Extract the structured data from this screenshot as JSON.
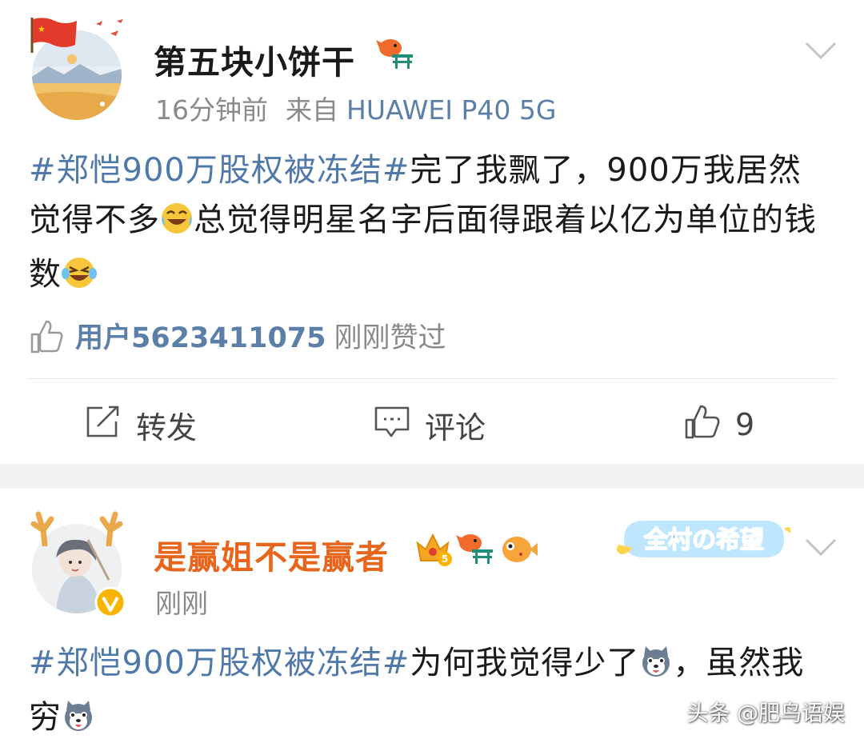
{
  "colors": {
    "topic": "#4f79ab",
    "vip_name": "#e8661c",
    "link": "#5c7fa8",
    "muted": "#8a8a8a"
  },
  "post1": {
    "username": "第五块小饼干",
    "time": "16分钟前",
    "from_label": "来自",
    "device": "HUAWEI P40 5G",
    "content": {
      "topic": "#郑恺900万股权被冻结#",
      "text1": "完了我飘了，900万我居然觉得不多",
      "text2": "总觉得明星名字后面得跟着以亿为单位的钱数"
    },
    "liked_by": {
      "user": "用户5623411075",
      "text": "刚刚赞过"
    },
    "actions": {
      "repost": "转发",
      "comment": "评论",
      "like_count": "9"
    }
  },
  "post2": {
    "username": "是赢姐不是赢者",
    "level": "5",
    "banner_text": "全村の希望",
    "time": "刚刚",
    "content": {
      "topic": "#郑恺900万股权被冻结#",
      "text1": "为何我觉得少了",
      "text2": "，虽然我穷"
    }
  },
  "watermark": "头条 @肥鸟语娱"
}
